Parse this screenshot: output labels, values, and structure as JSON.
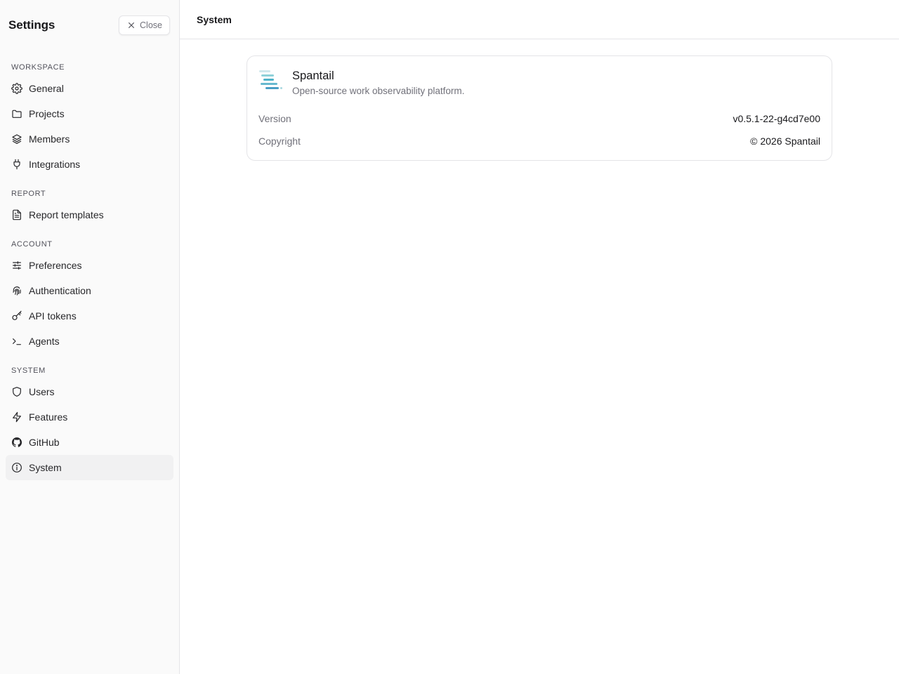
{
  "sidebar": {
    "title": "Settings",
    "close_label": "Close",
    "groups": [
      {
        "label": "WORKSPACE",
        "items": [
          {
            "label": "General",
            "icon": "gear-icon"
          },
          {
            "label": "Projects",
            "icon": "folder-icon"
          },
          {
            "label": "Members",
            "icon": "layers-icon"
          },
          {
            "label": "Integrations",
            "icon": "plug-icon"
          }
        ]
      },
      {
        "label": "REPORT",
        "items": [
          {
            "label": "Report templates",
            "icon": "file-text-icon"
          }
        ]
      },
      {
        "label": "ACCOUNT",
        "items": [
          {
            "label": "Preferences",
            "icon": "sliders-icon"
          },
          {
            "label": "Authentication",
            "icon": "fingerprint-icon"
          },
          {
            "label": "API tokens",
            "icon": "key-icon"
          },
          {
            "label": "Agents",
            "icon": "terminal-icon"
          }
        ]
      },
      {
        "label": "SYSTEM",
        "items": [
          {
            "label": "Users",
            "icon": "shield-icon"
          },
          {
            "label": "Features",
            "icon": "zap-icon"
          },
          {
            "label": "GitHub",
            "icon": "github-icon"
          },
          {
            "label": "System",
            "icon": "info-icon",
            "active": true
          }
        ]
      }
    ]
  },
  "main": {
    "title": "System",
    "app": {
      "name": "Spantail",
      "description": "Open-source work observability platform.",
      "logo_icon": "spantail-logo-icon"
    },
    "details": [
      {
        "label": "Version",
        "value": "v0.5.1-22-g4cd7e00"
      },
      {
        "label": "Copyright",
        "value": "© 2026 Spantail"
      }
    ]
  },
  "colors": {
    "sidebar_bg": "#fafafa",
    "active_item_bg": "#f1f1f2",
    "border": "#e4e4e7",
    "muted_text": "#71717a"
  }
}
